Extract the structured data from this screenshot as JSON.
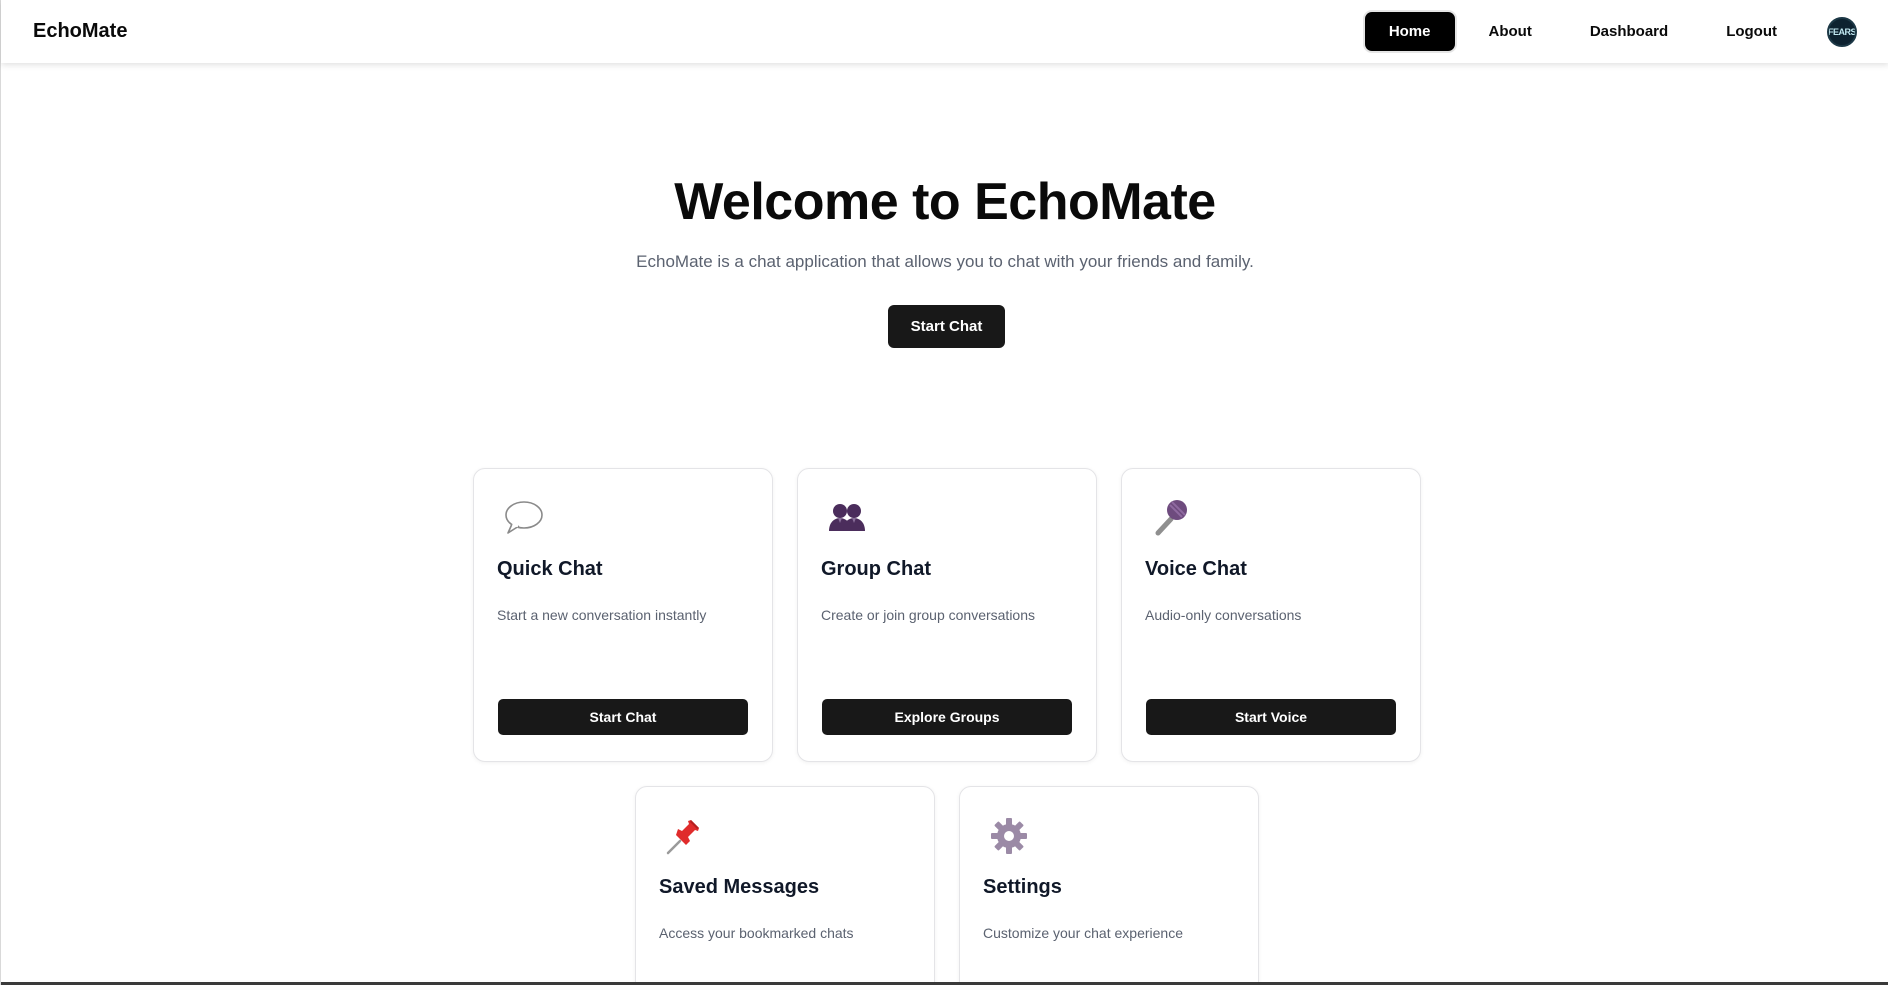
{
  "navbar": {
    "brand": "EchoMate",
    "links": [
      {
        "label": "Home",
        "active": true
      },
      {
        "label": "About",
        "active": false
      },
      {
        "label": "Dashboard",
        "active": false
      },
      {
        "label": "Logout",
        "active": false
      }
    ],
    "avatar_text": "FEARS"
  },
  "hero": {
    "title": "Welcome to EchoMate",
    "subtitle": "EchoMate is a chat application that allows you to chat with your friends and family.",
    "cta_label": "Start Chat"
  },
  "cards": [
    {
      "icon": "speech-bubble-icon",
      "title": "Quick Chat",
      "description": "Start a new conversation instantly",
      "button": "Start Chat"
    },
    {
      "icon": "people-icon",
      "title": "Group Chat",
      "description": "Create or join group conversations",
      "button": "Explore Groups"
    },
    {
      "icon": "microphone-icon",
      "title": "Voice Chat",
      "description": "Audio-only conversations",
      "button": "Start Voice"
    },
    {
      "icon": "pushpin-icon",
      "title": "Saved Messages",
      "description": "Access your bookmarked chats",
      "button": ""
    },
    {
      "icon": "gear-icon",
      "title": "Settings",
      "description": "Customize your chat experience",
      "button": ""
    }
  ],
  "colors": {
    "primary_button": "#181818",
    "active_nav": "#000000",
    "muted_text": "#5b6270"
  }
}
